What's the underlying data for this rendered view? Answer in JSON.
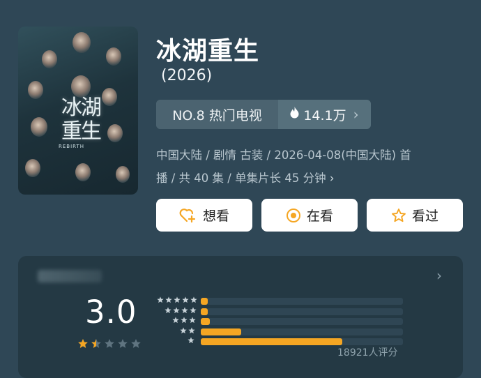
{
  "show": {
    "title": "冰湖重生",
    "year": "(2026)",
    "rank_label": "NO.8 热门电视",
    "heat_value": "14.1万",
    "meta_line1": "中国大陆 / 剧情 古装 / 2026-04-08(中国大陆) 首",
    "meta_line2": "播 / 共 40 集 / 单集片长 45 分钟"
  },
  "poster": {
    "calligraphy": "冰湖重生",
    "subtitle_en": "REBIRTH"
  },
  "actions": {
    "want_label": "想看",
    "watching_label": "在看",
    "watched_label": "看过"
  },
  "rating": {
    "score": "3.0",
    "star_rating": 1.5,
    "rating_count": "18921人评分",
    "distribution": [
      {
        "stars": 5,
        "fraction": 0.035
      },
      {
        "stars": 4,
        "fraction": 0.035
      },
      {
        "stars": 3,
        "fraction": 0.045
      },
      {
        "stars": 2,
        "fraction": 0.2
      },
      {
        "stars": 1,
        "fraction": 0.7
      }
    ]
  },
  "colors": {
    "background": "#2f4756",
    "accent_orange": "#f5a623",
    "heart_orange": "#f5a623"
  },
  "icons": {
    "heat": "flame-icon",
    "want": "heart-plus-icon",
    "watching": "target-icon",
    "watched": "star-outline-icon",
    "more": "chevron-right-icon"
  }
}
